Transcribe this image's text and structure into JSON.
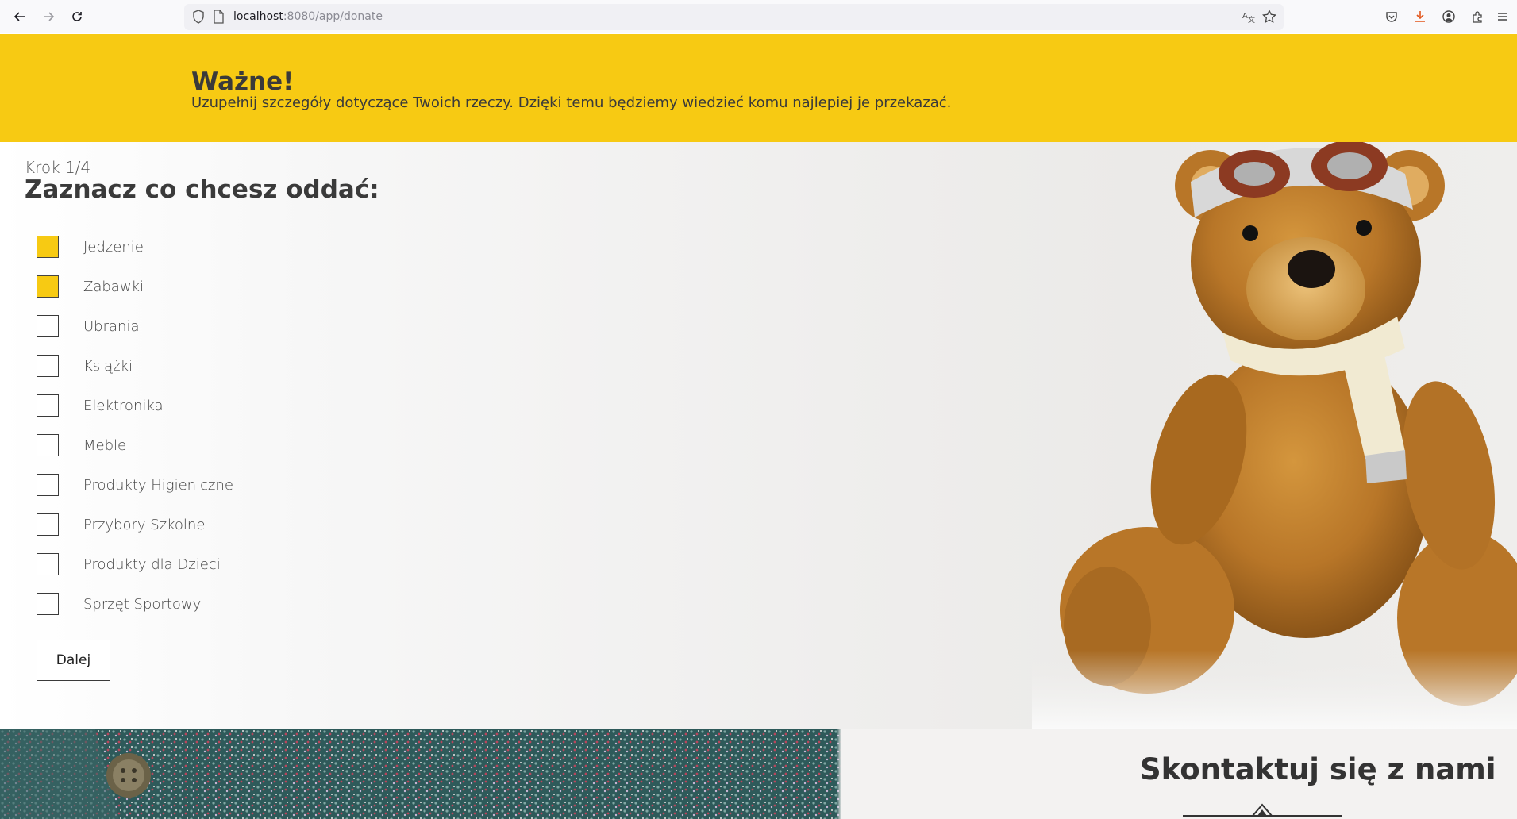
{
  "browser": {
    "url_host": "localhost",
    "url_rest": ":8080/app/donate"
  },
  "banner": {
    "title": "Ważne!",
    "text": "Uzupełnij szczegóły dotyczące Twoich rzeczy. Dzięki temu będziemy wiedzieć komu najlepiej je przekazać."
  },
  "form": {
    "step": "Krok 1/4",
    "question": "Zaznacz co chcesz oddać:",
    "options": [
      {
        "label": "Jedzenie",
        "checked": true
      },
      {
        "label": "Zabawki",
        "checked": true
      },
      {
        "label": "Ubrania",
        "checked": false
      },
      {
        "label": "Książki",
        "checked": false
      },
      {
        "label": "Elektronika",
        "checked": false
      },
      {
        "label": "Meble",
        "checked": false
      },
      {
        "label": "Produkty Higieniczne",
        "checked": false
      },
      {
        "label": "Przybory Szkolne",
        "checked": false
      },
      {
        "label": "Produkty dla Dzieci",
        "checked": false
      },
      {
        "label": "Sprzęt Sportowy",
        "checked": false
      }
    ],
    "next_label": "Dalej"
  },
  "contact": {
    "title": "Skontaktuj się z nami"
  },
  "colors": {
    "accent": "#f7ca13",
    "text": "#3a3a3a"
  }
}
